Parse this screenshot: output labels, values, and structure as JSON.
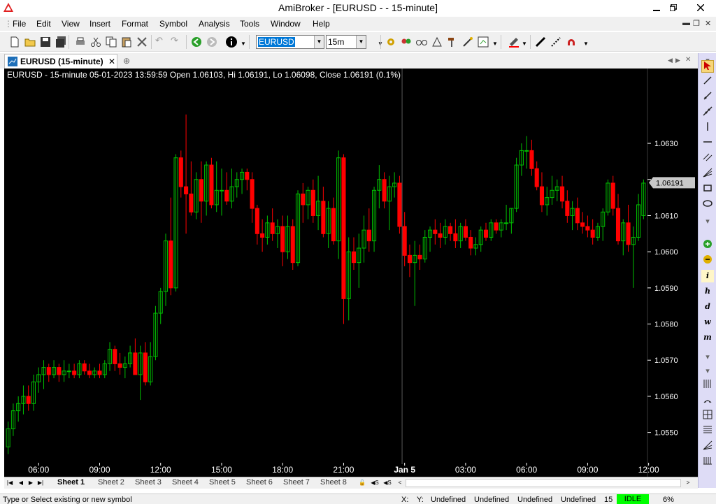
{
  "app": {
    "title": "AmiBroker - [EURUSD -  - 15-minute]"
  },
  "menu": {
    "items": [
      "File",
      "Edit",
      "View",
      "Insert",
      "Format",
      "Symbol",
      "Analysis",
      "Tools",
      "Window",
      "Help"
    ]
  },
  "toolbar": {
    "symbol_value": "EURUSD",
    "interval_value": "15m"
  },
  "tab": {
    "label": "EURUSD (15-minute)"
  },
  "chart_header": "EURUSD - 15-minute 05-01-2023 13:59:59 Open 1.06103, Hi 1.06191, Lo 1.06098, Close 1.06191 (0.1%)",
  "sheets": {
    "tabs": [
      "Sheet 1",
      "Sheet 2",
      "Sheet 3",
      "Sheet 4",
      "Sheet 5",
      "Sheet 6",
      "Sheet 7",
      "Sheet 8"
    ],
    "active": "Sheet 1"
  },
  "status": {
    "hint": "Type or Select existing or new symbol",
    "x_label": "X:",
    "y_label": "Y:",
    "undefined1": "Undefined",
    "undefined2": "Undefined",
    "undefined3": "Undefined",
    "undefined4": "Undefined",
    "count": "15",
    "state": "IDLE",
    "percent": "6%"
  },
  "colors": {
    "background": "#000000",
    "up_candle": "#00c000",
    "down_candle": "#ff0000",
    "axis_text": "#ffffff",
    "last_price_box": "#c8c8c8",
    "right_toolbar": "#dedcf6",
    "idle_badge": "#00ff00"
  },
  "chart_data": {
    "type": "candlestick",
    "title": "EURUSD - 15-minute 05-01-2023 13:59:59 Open 1.06103, Hi 1.06191, Lo 1.06098, Close 1.06191 (0.1%)",
    "ylim": [
      1.0542,
      1.0648
    ],
    "y_ticks": [
      1.063,
      1.062,
      1.061,
      1.06,
      1.059,
      1.058,
      1.057,
      1.056,
      1.055
    ],
    "y_tick_labels": [
      "1.0630",
      "",
      "1.0610",
      "1.0600",
      "1.0590",
      "1.0580",
      "1.0570",
      "1.0560",
      "1.0550"
    ],
    "last_price_label": "1.06191",
    "last_price": 1.06191,
    "x_tick_labels": [
      "06:00",
      "09:00",
      "12:00",
      "15:00",
      "18:00",
      "21:00",
      "Jan 5",
      "03:00",
      "06:00",
      "09:00",
      "12:00"
    ],
    "x_tick_bar_index": [
      6,
      18,
      30,
      42,
      54,
      66,
      78,
      90,
      102,
      114,
      126
    ],
    "date_separator_bar_index": 78,
    "candles": [
      [
        1.0546,
        1.0553,
        1.0544,
        1.0551
      ],
      [
        1.0551,
        1.0558,
        1.0549,
        1.0556
      ],
      [
        1.0556,
        1.056,
        1.0553,
        1.0558
      ],
      [
        1.0558,
        1.0563,
        1.0555,
        1.056
      ],
      [
        1.056,
        1.0563,
        1.0556,
        1.0558
      ],
      [
        1.0558,
        1.0566,
        1.0556,
        1.0564
      ],
      [
        1.0564,
        1.0568,
        1.0561,
        1.0566
      ],
      [
        1.0566,
        1.057,
        1.0562,
        1.0568
      ],
      [
        1.0568,
        1.0569,
        1.0564,
        1.0566
      ],
      [
        1.0566,
        1.057,
        1.0565,
        1.0568
      ],
      [
        1.0568,
        1.0569,
        1.0564,
        1.0566
      ],
      [
        1.0566,
        1.057,
        1.0564,
        1.0567
      ],
      [
        1.0567,
        1.0569,
        1.0565,
        1.0567
      ],
      [
        1.0567,
        1.0569,
        1.0565,
        1.0566
      ],
      [
        1.0566,
        1.057,
        1.0565,
        1.0569
      ],
      [
        1.0569,
        1.057,
        1.0566,
        1.0567
      ],
      [
        1.0567,
        1.0569,
        1.0565,
        1.0566
      ],
      [
        1.0566,
        1.0568,
        1.0565,
        1.0567
      ],
      [
        1.0567,
        1.0569,
        1.0565,
        1.0566
      ],
      [
        1.0566,
        1.057,
        1.0565,
        1.0569
      ],
      [
        1.0569,
        1.0575,
        1.0567,
        1.0573
      ],
      [
        1.0573,
        1.0574,
        1.0567,
        1.0569
      ],
      [
        1.0569,
        1.0572,
        1.0566,
        1.0568
      ],
      [
        1.0568,
        1.0571,
        1.0565,
        1.0569
      ],
      [
        1.0569,
        1.0574,
        1.0568,
        1.0572
      ],
      [
        1.0572,
        1.0576,
        1.0566,
        1.0566
      ],
      [
        1.0566,
        1.0574,
        1.0559,
        1.0572
      ],
      [
        1.0572,
        1.0575,
        1.0563,
        1.0564
      ],
      [
        1.0564,
        1.0575,
        1.0563,
        1.0571
      ],
      [
        1.0571,
        1.0585,
        1.057,
        1.0583
      ],
      [
        1.0583,
        1.059,
        1.058,
        1.0589
      ],
      [
        1.0589,
        1.0605,
        1.0585,
        1.0603
      ],
      [
        1.0603,
        1.0615,
        1.0588,
        1.059
      ],
      [
        1.059,
        1.0627,
        1.0589,
        1.0626
      ],
      [
        1.0626,
        1.0628,
        1.0615,
        1.0618
      ],
      [
        1.0618,
        1.0638,
        1.0605,
        1.0616
      ],
      [
        1.0616,
        1.0625,
        1.061,
        1.0611
      ],
      [
        1.0611,
        1.0622,
        1.0609,
        1.062
      ],
      [
        1.062,
        1.0625,
        1.0608,
        1.0614
      ],
      [
        1.0614,
        1.0625,
        1.061,
        1.0624
      ],
      [
        1.0624,
        1.0626,
        1.0612,
        1.0613
      ],
      [
        1.0613,
        1.0625,
        1.0611,
        1.0617
      ],
      [
        1.0617,
        1.0623,
        1.061,
        1.0617
      ],
      [
        1.0617,
        1.0622,
        1.0613,
        1.0614
      ],
      [
        1.0614,
        1.0623,
        1.0612,
        1.0618
      ],
      [
        1.0618,
        1.0622,
        1.0615,
        1.062
      ],
      [
        1.062,
        1.0623,
        1.0616,
        1.0622
      ],
      [
        1.0622,
        1.0623,
        1.0617,
        1.062
      ],
      [
        1.062,
        1.0622,
        1.0608,
        1.0612
      ],
      [
        1.0612,
        1.0613,
        1.0602,
        1.0605
      ],
      [
        1.0605,
        1.0609,
        1.06,
        1.0604
      ],
      [
        1.0604,
        1.061,
        1.0602,
        1.0608
      ],
      [
        1.0608,
        1.0612,
        1.0603,
        1.0605
      ],
      [
        1.0605,
        1.0609,
        1.0601,
        1.0607
      ],
      [
        1.0607,
        1.061,
        1.0596,
        1.06
      ],
      [
        1.06,
        1.061,
        1.0598,
        1.0607
      ],
      [
        1.0607,
        1.0609,
        1.0595,
        1.0597
      ],
      [
        1.0597,
        1.0617,
        1.0596,
        1.0616
      ],
      [
        1.0616,
        1.0619,
        1.0608,
        1.0613
      ],
      [
        1.0613,
        1.0618,
        1.0609,
        1.0617
      ],
      [
        1.0617,
        1.062,
        1.0608,
        1.061
      ],
      [
        1.061,
        1.0621,
        1.0606,
        1.0614
      ],
      [
        1.0614,
        1.0618,
        1.0604,
        1.0605
      ],
      [
        1.0605,
        1.0614,
        1.0601,
        1.0612
      ],
      [
        1.0612,
        1.0615,
        1.0602,
        1.0603
      ],
      [
        1.0603,
        1.0628,
        1.0598,
        1.0626
      ],
      [
        1.0626,
        1.0627,
        1.058,
        1.0587
      ],
      [
        1.0587,
        1.0604,
        1.0581,
        1.06
      ],
      [
        1.06,
        1.0604,
        1.0595,
        1.0597
      ],
      [
        1.0597,
        1.0605,
        1.059,
        1.0601
      ],
      [
        1.0601,
        1.061,
        1.0597,
        1.0606
      ],
      [
        1.0606,
        1.0612,
        1.06,
        1.0603
      ],
      [
        1.0603,
        1.0618,
        1.06,
        1.0617
      ],
      [
        1.0617,
        1.0624,
        1.0612,
        1.062
      ],
      [
        1.062,
        1.0622,
        1.0612,
        1.0614
      ],
      [
        1.0614,
        1.0621,
        1.0606,
        1.0618
      ],
      [
        1.0618,
        1.0622,
        1.0615,
        1.0619
      ],
      [
        1.0619,
        1.0621,
        1.0605,
        1.0607
      ],
      [
        1.0607,
        1.0611,
        1.0596,
        1.0599
      ],
      [
        1.0599,
        1.0602,
        1.0593,
        1.0597
      ],
      [
        1.0597,
        1.0603,
        1.0585,
        1.0599
      ],
      [
        1.0599,
        1.0602,
        1.0595,
        1.0598
      ],
      [
        1.0598,
        1.0606,
        1.0597,
        1.0604
      ],
      [
        1.0604,
        1.0607,
        1.06,
        1.0606
      ],
      [
        1.0606,
        1.0609,
        1.0602,
        1.0605
      ],
      [
        1.0605,
        1.0608,
        1.0601,
        1.0604
      ],
      [
        1.0604,
        1.0609,
        1.0602,
        1.0607
      ],
      [
        1.0607,
        1.0608,
        1.0603,
        1.0605
      ],
      [
        1.0605,
        1.0609,
        1.0601,
        1.0603
      ],
      [
        1.0603,
        1.0608,
        1.0601,
        1.0607
      ],
      [
        1.0607,
        1.0609,
        1.0603,
        1.0604
      ],
      [
        1.0604,
        1.0606,
        1.0599,
        1.0601
      ],
      [
        1.0601,
        1.0604,
        1.0599,
        1.0602
      ],
      [
        1.0602,
        1.0607,
        1.06,
        1.0606
      ],
      [
        1.0606,
        1.0608,
        1.0603,
        1.0604
      ],
      [
        1.0604,
        1.0609,
        1.0603,
        1.0608
      ],
      [
        1.0608,
        1.0609,
        1.0605,
        1.0606
      ],
      [
        1.0606,
        1.0609,
        1.0604,
        1.0608
      ],
      [
        1.0608,
        1.0613,
        1.0606,
        1.0608
      ],
      [
        1.0608,
        1.0612,
        1.0605,
        1.0612
      ],
      [
        1.0612,
        1.0626,
        1.0611,
        1.0624
      ],
      [
        1.0624,
        1.063,
        1.0621,
        1.0628
      ],
      [
        1.0628,
        1.0632,
        1.0623,
        1.0628
      ],
      [
        1.0628,
        1.0631,
        1.0621,
        1.0623
      ],
      [
        1.0623,
        1.0625,
        1.0617,
        1.0618
      ],
      [
        1.0618,
        1.0622,
        1.0611,
        1.0613
      ],
      [
        1.0613,
        1.0618,
        1.061,
        1.0615
      ],
      [
        1.0615,
        1.0621,
        1.0613,
        1.0617
      ],
      [
        1.0617,
        1.062,
        1.0614,
        1.0618
      ],
      [
        1.0618,
        1.0621,
        1.0612,
        1.0614
      ],
      [
        1.0614,
        1.0617,
        1.0608,
        1.061
      ],
      [
        1.061,
        1.0614,
        1.0606,
        1.0612
      ],
      [
        1.0612,
        1.0615,
        1.0606,
        1.0608
      ],
      [
        1.0608,
        1.0611,
        1.0605,
        1.0607
      ],
      [
        1.0607,
        1.061,
        1.0604,
        1.0606
      ],
      [
        1.0606,
        1.0609,
        1.0602,
        1.0604
      ],
      [
        1.0604,
        1.0608,
        1.0603,
        1.0607
      ],
      [
        1.0607,
        1.0612,
        1.0603,
        1.0611
      ],
      [
        1.0611,
        1.062,
        1.061,
        1.0619
      ],
      [
        1.0619,
        1.0621,
        1.061,
        1.0612
      ],
      [
        1.0612,
        1.0616,
        1.0602,
        1.0603
      ],
      [
        1.0603,
        1.0609,
        1.0599,
        1.0608
      ],
      [
        1.0608,
        1.0613,
        1.06,
        1.0602
      ],
      [
        1.0602,
        1.0607,
        1.059,
        1.0604
      ],
      [
        1.0604,
        1.0616,
        1.0603,
        1.0613
      ],
      [
        1.061,
        1.062,
        1.0609,
        1.0619
      ]
    ]
  }
}
